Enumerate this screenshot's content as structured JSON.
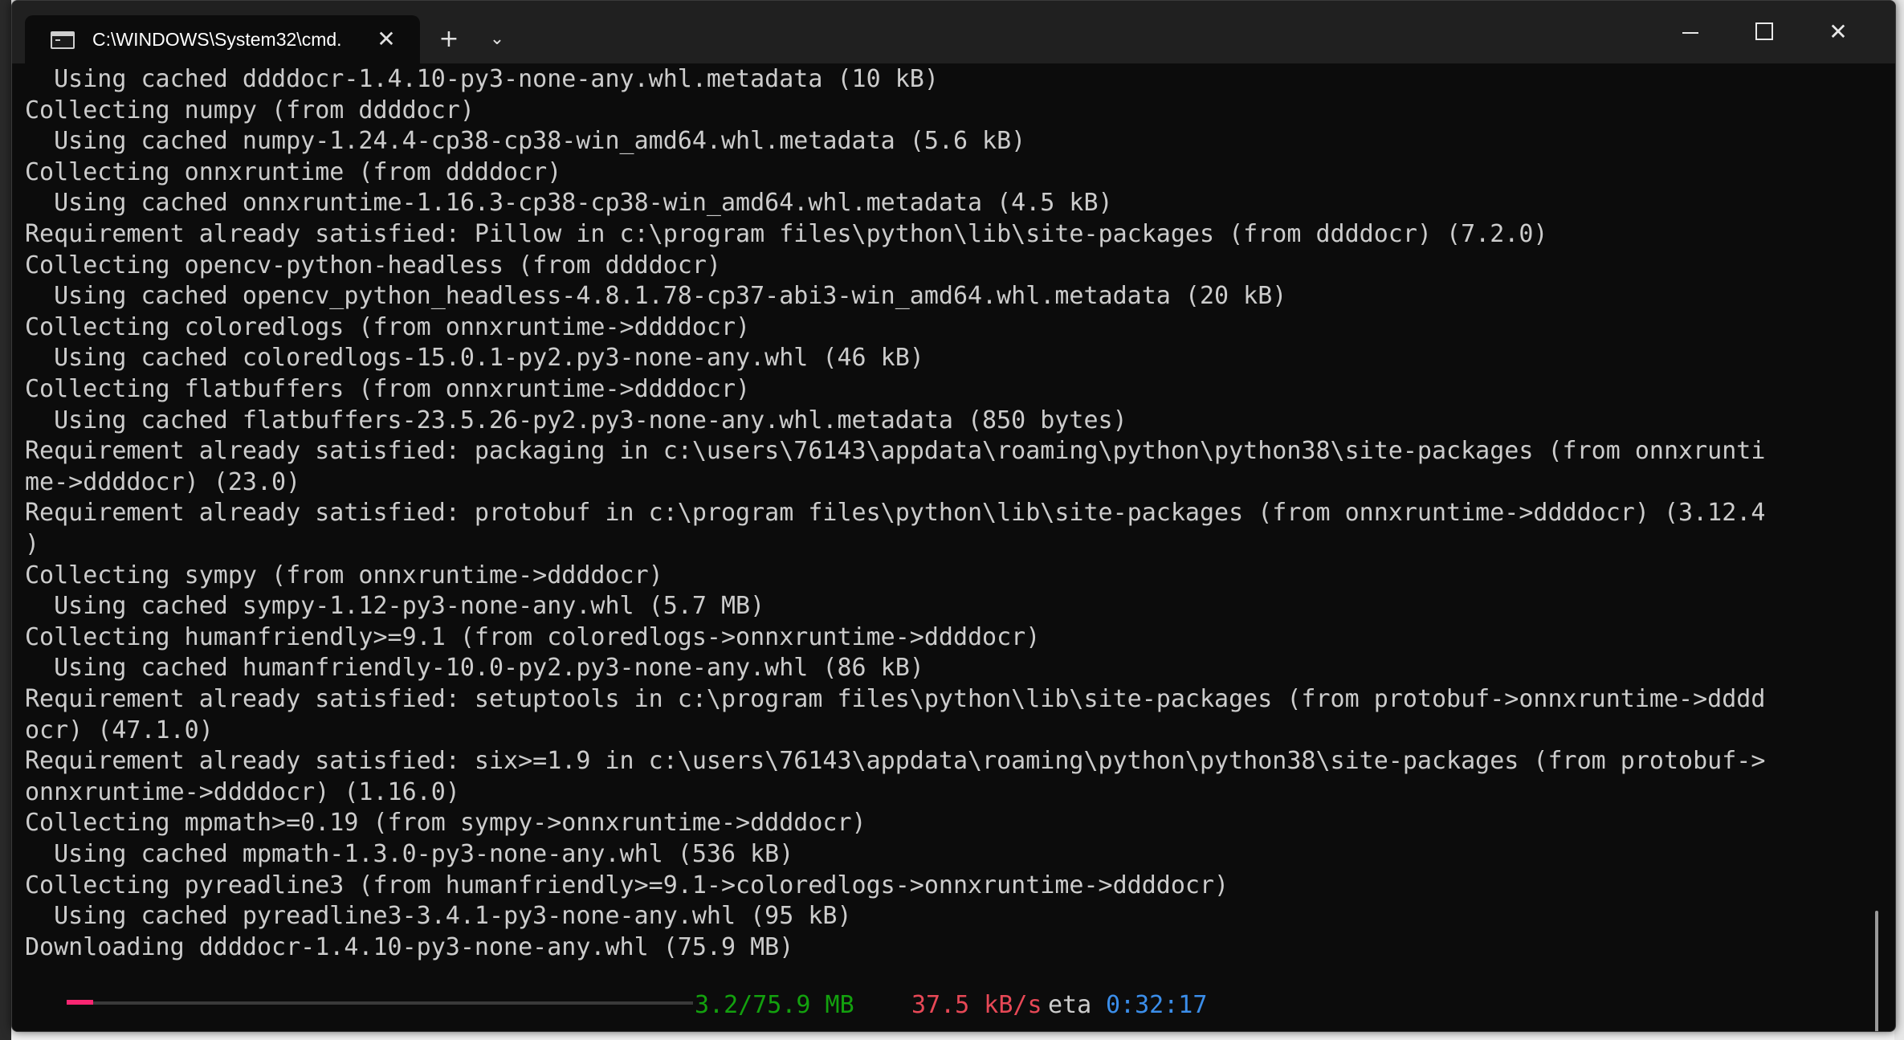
{
  "window": {
    "tab_title": "C:\\WINDOWS\\System32\\cmd.",
    "tab_close": "✕",
    "new_tab": "+",
    "tab_dropdown": "⌄",
    "close_glyph": "✕"
  },
  "console": {
    "lines": [
      "  Using cached ddddocr-1.4.10-py3-none-any.whl.metadata (10 kB)",
      "Collecting numpy (from ddddocr)",
      "  Using cached numpy-1.24.4-cp38-cp38-win_amd64.whl.metadata (5.6 kB)",
      "Collecting onnxruntime (from ddddocr)",
      "  Using cached onnxruntime-1.16.3-cp38-cp38-win_amd64.whl.metadata (4.5 kB)",
      "Requirement already satisfied: Pillow in c:\\program files\\python\\lib\\site-packages (from ddddocr) (7.2.0)",
      "Collecting opencv-python-headless (from ddddocr)",
      "  Using cached opencv_python_headless-4.8.1.78-cp37-abi3-win_amd64.whl.metadata (20 kB)",
      "Collecting coloredlogs (from onnxruntime->ddddocr)",
      "  Using cached coloredlogs-15.0.1-py2.py3-none-any.whl (46 kB)",
      "Collecting flatbuffers (from onnxruntime->ddddocr)",
      "  Using cached flatbuffers-23.5.26-py2.py3-none-any.whl.metadata (850 bytes)",
      "Requirement already satisfied: packaging in c:\\users\\76143\\appdata\\roaming\\python\\python38\\site-packages (from onnxrunti",
      "me->ddddocr) (23.0)",
      "Requirement already satisfied: protobuf in c:\\program files\\python\\lib\\site-packages (from onnxruntime->ddddocr) (3.12.4",
      ")",
      "Collecting sympy (from onnxruntime->ddddocr)",
      "  Using cached sympy-1.12-py3-none-any.whl (5.7 MB)",
      "Collecting humanfriendly>=9.1 (from coloredlogs->onnxruntime->ddddocr)",
      "  Using cached humanfriendly-10.0-py2.py3-none-any.whl (86 kB)",
      "Requirement already satisfied: setuptools in c:\\program files\\python\\lib\\site-packages (from protobuf->onnxruntime->dddd",
      "ocr) (47.1.0)",
      "Requirement already satisfied: six>=1.9 in c:\\users\\76143\\appdata\\roaming\\python\\python38\\site-packages (from protobuf->",
      "onnxruntime->ddddocr) (1.16.0)",
      "Collecting mpmath>=0.19 (from sympy->onnxruntime->ddddocr)",
      "  Using cached mpmath-1.3.0-py3-none-any.whl (536 kB)",
      "Collecting pyreadline3 (from humanfriendly>=9.1->coloredlogs->onnxruntime->ddddocr)",
      "  Using cached pyreadline3-3.4.1-py3-none-any.whl (95 kB)",
      "Downloading ddddocr-1.4.10-py3-none-any.whl (75.9 MB)"
    ],
    "progress": {
      "fraction": 0.042,
      "done_text": "3.2/75.9 MB",
      "speed_text": "37.5 kB/s",
      "eta_label": "eta",
      "eta_text": "0:32:17",
      "fill_color": "#f92672",
      "done_color": "#13a10e",
      "speed_color": "#e74856",
      "eta_color": "#3b8eea"
    }
  }
}
